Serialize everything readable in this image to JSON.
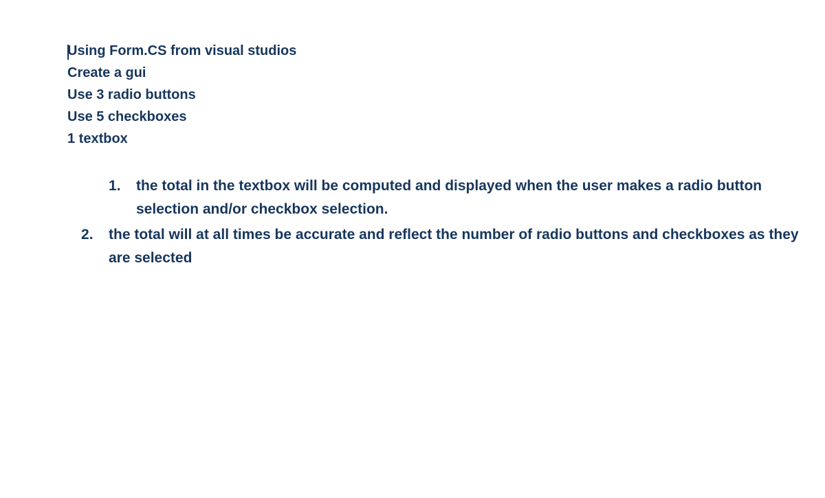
{
  "intro": {
    "line1": "Using Form.CS from visual studios",
    "line2": "Create a gui",
    "line3": "Use 3 radio buttons",
    "line4": "Use 5 checkboxes",
    "line5": "1 textbox"
  },
  "list": {
    "item1": "the total in the textbox will be computed and displayed when the user makes a radio button selection and/or checkbox selection.",
    "item2": "the total will at all times be accurate and reflect the number of radio buttons and checkboxes as they are selected"
  }
}
